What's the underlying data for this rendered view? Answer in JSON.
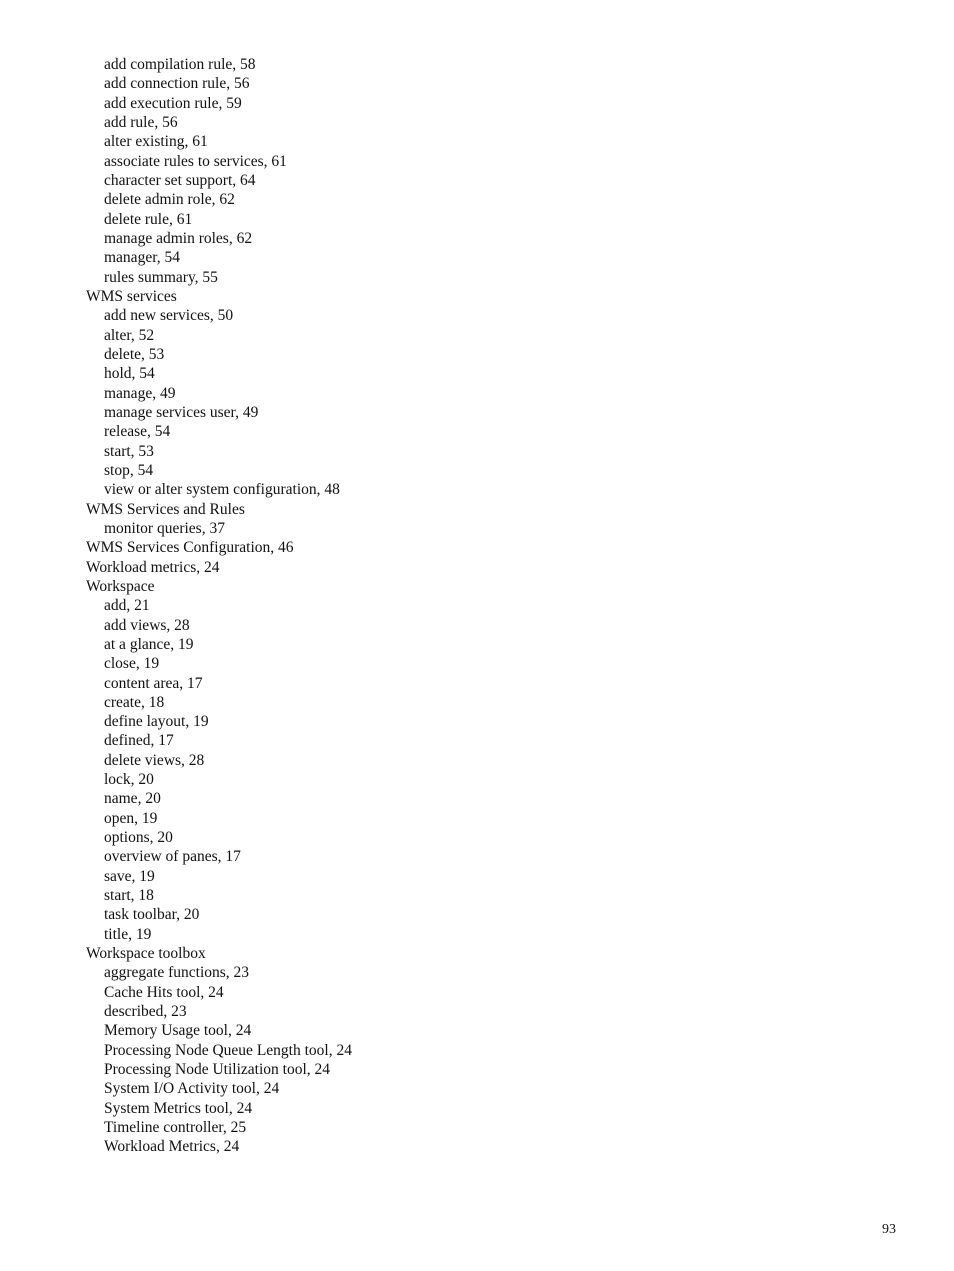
{
  "document": {
    "page_number": "93",
    "entries": [
      {
        "level": 2,
        "text": "add compilation rule, 58"
      },
      {
        "level": 2,
        "text": "add connection rule, 56"
      },
      {
        "level": 2,
        "text": "add execution rule, 59"
      },
      {
        "level": 2,
        "text": "add rule, 56"
      },
      {
        "level": 2,
        "text": "alter existing, 61"
      },
      {
        "level": 2,
        "text": "associate rules to services, 61"
      },
      {
        "level": 2,
        "text": "character set support, 64"
      },
      {
        "level": 2,
        "text": "delete admin role, 62"
      },
      {
        "level": 2,
        "text": "delete rule, 61"
      },
      {
        "level": 2,
        "text": "manage admin roles, 62"
      },
      {
        "level": 2,
        "text": "manager, 54"
      },
      {
        "level": 2,
        "text": "rules summary, 55"
      },
      {
        "level": 1,
        "text": "WMS services"
      },
      {
        "level": 2,
        "text": "add new services, 50"
      },
      {
        "level": 2,
        "text": "alter, 52"
      },
      {
        "level": 2,
        "text": "delete, 53"
      },
      {
        "level": 2,
        "text": "hold, 54"
      },
      {
        "level": 2,
        "text": "manage, 49"
      },
      {
        "level": 2,
        "text": "manage services user, 49"
      },
      {
        "level": 2,
        "text": "release, 54"
      },
      {
        "level": 2,
        "text": "start, 53"
      },
      {
        "level": 2,
        "text": "stop, 54"
      },
      {
        "level": 2,
        "text": "view or alter system configuration, 48"
      },
      {
        "level": 1,
        "text": "WMS Services and Rules"
      },
      {
        "level": 2,
        "text": "monitor queries, 37"
      },
      {
        "level": 1,
        "text": "WMS Services Configuration, 46"
      },
      {
        "level": 1,
        "text": "Workload metrics, 24"
      },
      {
        "level": 1,
        "text": "Workspace"
      },
      {
        "level": 2,
        "text": "add, 21"
      },
      {
        "level": 2,
        "text": "add views, 28"
      },
      {
        "level": 2,
        "text": "at a glance, 19"
      },
      {
        "level": 2,
        "text": "close, 19"
      },
      {
        "level": 2,
        "text": "content area, 17"
      },
      {
        "level": 2,
        "text": "create, 18"
      },
      {
        "level": 2,
        "text": "define layout, 19"
      },
      {
        "level": 2,
        "text": "defined, 17"
      },
      {
        "level": 2,
        "text": "delete views, 28"
      },
      {
        "level": 2,
        "text": "lock, 20"
      },
      {
        "level": 2,
        "text": "name, 20"
      },
      {
        "level": 2,
        "text": "open, 19"
      },
      {
        "level": 2,
        "text": "options, 20"
      },
      {
        "level": 2,
        "text": "overview of panes, 17"
      },
      {
        "level": 2,
        "text": "save, 19"
      },
      {
        "level": 2,
        "text": "start, 18"
      },
      {
        "level": 2,
        "text": "task toolbar, 20"
      },
      {
        "level": 2,
        "text": "title, 19"
      },
      {
        "level": 1,
        "text": "Workspace toolbox"
      },
      {
        "level": 2,
        "text": "aggregate functions, 23"
      },
      {
        "level": 2,
        "text": "Cache Hits tool, 24"
      },
      {
        "level": 2,
        "text": "described, 23"
      },
      {
        "level": 2,
        "text": "Memory Usage tool, 24"
      },
      {
        "level": 2,
        "text": "Processing Node Queue Length tool, 24"
      },
      {
        "level": 2,
        "text": "Processing Node Utilization tool, 24"
      },
      {
        "level": 2,
        "text": "System I/O Activity tool, 24"
      },
      {
        "level": 2,
        "text": "System Metrics tool, 24"
      },
      {
        "level": 2,
        "text": "Timeline controller, 25"
      },
      {
        "level": 2,
        "text": "Workload Metrics, 24"
      }
    ]
  }
}
